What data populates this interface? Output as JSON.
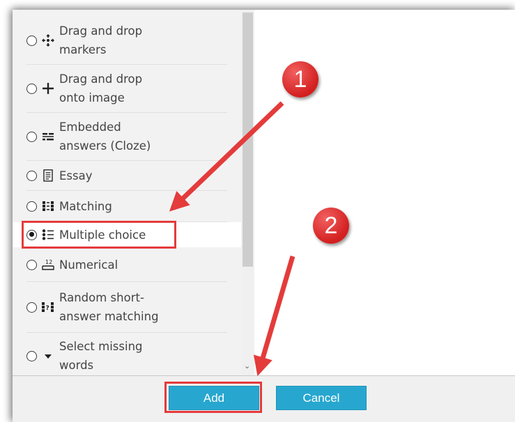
{
  "question_types": [
    {
      "label": "Drag and drop\nmarkers",
      "icon": "drag-drop-markers-icon",
      "selected": false
    },
    {
      "label": "Drag and drop\nonto image",
      "icon": "drag-drop-image-icon",
      "selected": false
    },
    {
      "label": "Embedded\nanswers (Cloze)",
      "icon": "embedded-answers-icon",
      "selected": false
    },
    {
      "label": "Essay",
      "icon": "essay-icon",
      "selected": false
    },
    {
      "label": "Matching",
      "icon": "matching-icon",
      "selected": false
    },
    {
      "label": "Multiple choice",
      "icon": "multiple-choice-icon",
      "selected": true
    },
    {
      "label": "Numerical",
      "icon": "numerical-icon",
      "selected": false
    },
    {
      "label": "Random short-\nanswer matching",
      "icon": "random-short-answer-icon",
      "selected": false
    },
    {
      "label": "Select missing\nwords",
      "icon": "select-missing-words-icon",
      "selected": false
    }
  ],
  "footer": {
    "add_label": "Add",
    "cancel_label": "Cancel"
  },
  "callouts": {
    "step1": "1",
    "step2": "2"
  },
  "colors": {
    "button": "#27a7cf",
    "highlight": "#e43b3b",
    "list_bg": "#f2f2f2"
  }
}
